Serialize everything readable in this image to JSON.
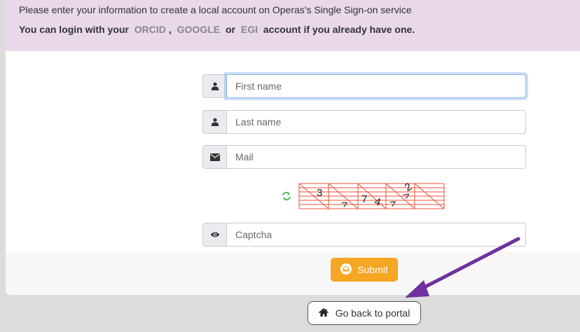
{
  "notice": {
    "line1": "Please enter your information to create a local account on Operas's Single Sign-on service",
    "line2_prefix": "You can login with your",
    "provider1": "ORCID",
    "sep1": ",",
    "provider2": "GOOGLE",
    "or": "or",
    "provider3": "EGI",
    "line2_suffix": "account if you already have one."
  },
  "form": {
    "first_name": {
      "placeholder": "First name",
      "icon": "user-icon"
    },
    "last_name": {
      "placeholder": "Last name",
      "icon": "user-icon"
    },
    "mail": {
      "placeholder": "Mail",
      "icon": "envelope-icon"
    },
    "captcha": {
      "placeholder": "Captcha",
      "icon": "eye-icon",
      "refresh_icon": "refresh-icon"
    },
    "submit_label": "Submit",
    "submit_icon": "envelope-open-icon"
  },
  "back_button": {
    "label": "Go back to portal",
    "icon": "home-icon"
  },
  "colors": {
    "notice_bg": "#e8d8ea",
    "provider_text": "#888888",
    "submit_bg": "#f5a623",
    "annotation_arrow": "#7030a0",
    "captcha_lines": "#e8533a",
    "refresh_icon": "#5cb85c"
  }
}
